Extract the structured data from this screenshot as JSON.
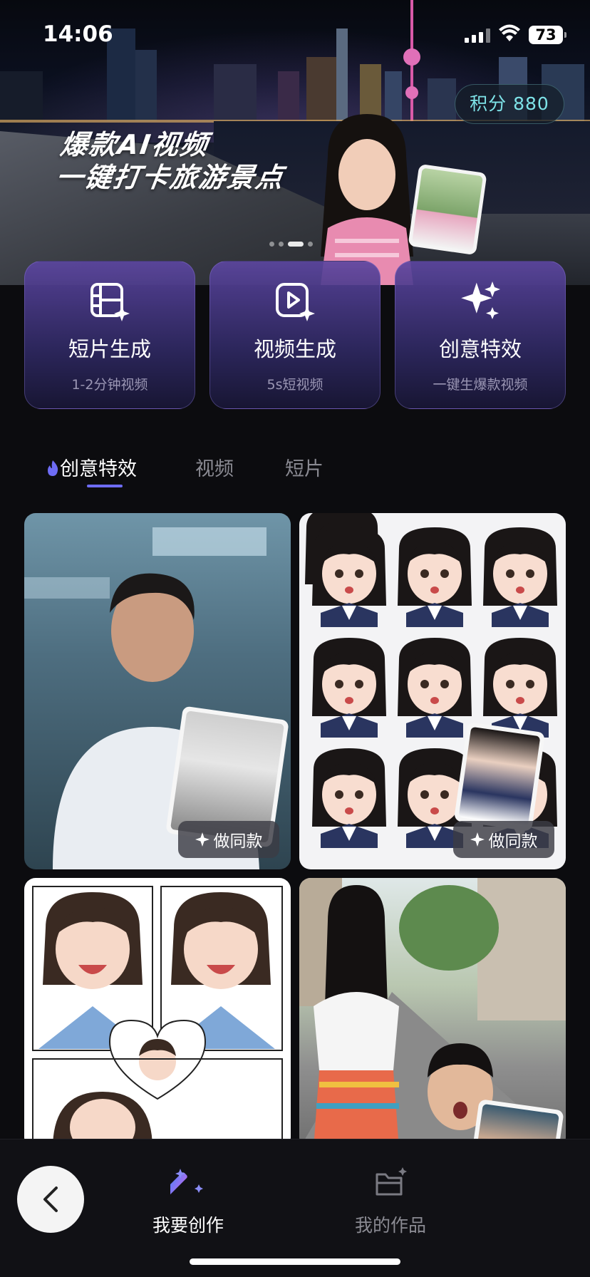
{
  "status_bar": {
    "time": "14:06",
    "battery": "73"
  },
  "banner": {
    "title_line1": "爆款AI视频",
    "title_line2": "一键打卡旅游景点",
    "points_label": "积分 880",
    "slides_total": 4,
    "active_slide": 2
  },
  "features": [
    {
      "title": "短片生成",
      "subtitle": "1-2分钟视频",
      "icon": "film-sparkle-icon"
    },
    {
      "title": "视频生成",
      "subtitle": "5s短视频",
      "icon": "play-sparkle-icon"
    },
    {
      "title": "创意特效",
      "subtitle": "一键生爆款视频",
      "icon": "sparkles-icon"
    }
  ],
  "tabs": [
    {
      "label": "创意特效",
      "active": true,
      "icon": "flame-icon"
    },
    {
      "label": "视频",
      "active": false
    },
    {
      "label": "短片",
      "active": false
    }
  ],
  "cards": [
    {
      "action_label": "做同款"
    },
    {
      "action_label": "做同款"
    }
  ],
  "bottom_nav": [
    {
      "label": "我要创作",
      "active": true,
      "icon": "magic-wand-icon"
    },
    {
      "label": "我的作品",
      "active": false,
      "icon": "folder-icon"
    }
  ],
  "colors": {
    "accent": "#6e6cf5",
    "points_text": "#7ee3e8",
    "background": "#0c0c0f"
  }
}
